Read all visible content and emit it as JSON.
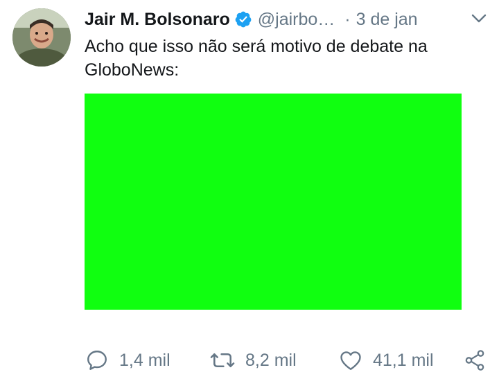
{
  "tweet": {
    "display_name": "Jair M. Bolsonaro",
    "handle": "@jairbo…",
    "separator": "·",
    "timestamp": "3 de jan",
    "text": "Acho que isso não será motivo de debate na GloboNews:",
    "media_color": "#10ff10"
  },
  "actions": {
    "reply_count": "1,4 mil",
    "retweet_count": "8,2 mil",
    "like_count": "41,1 mil"
  },
  "icons": [
    "avatar",
    "verified-badge-icon",
    "caret-down-icon",
    "reply-icon",
    "retweet-icon",
    "like-icon",
    "share-icon"
  ],
  "colors": {
    "primary_text": "#14171a",
    "secondary_text": "#657786",
    "verified_blue": "#1da1f2"
  }
}
